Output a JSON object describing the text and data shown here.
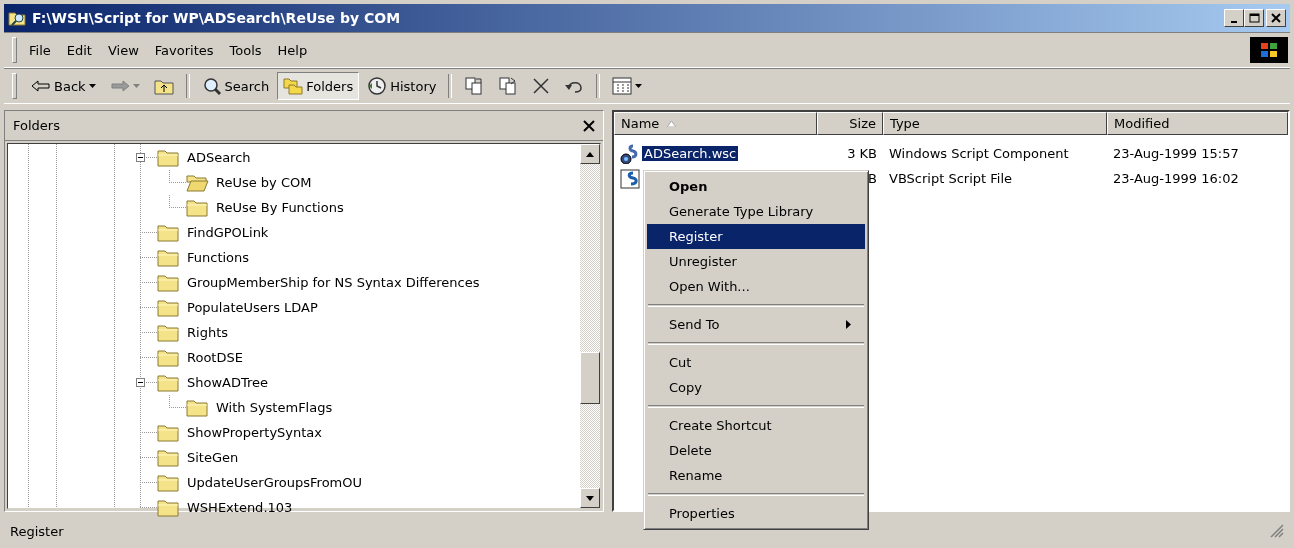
{
  "window": {
    "title": "F:\\WSH\\Script for WP\\ADSearch\\ReUse by COM"
  },
  "menu_bar": [
    "File",
    "Edit",
    "View",
    "Favorites",
    "Tools",
    "Help"
  ],
  "toolbar": [
    {
      "kind": "back",
      "label": "Back",
      "dropdown": true,
      "disabled": false
    },
    {
      "kind": "forward",
      "dropdown": true,
      "disabled": true
    },
    {
      "kind": "up"
    },
    {
      "kind": "separator"
    },
    {
      "kind": "search",
      "label": "Search",
      "pressed": false
    },
    {
      "kind": "folders",
      "label": "Folders",
      "pressed": true
    },
    {
      "kind": "history",
      "label": "History",
      "pressed": false
    },
    {
      "kind": "separator"
    },
    {
      "kind": "moveto"
    },
    {
      "kind": "copyto"
    },
    {
      "kind": "delete"
    },
    {
      "kind": "undo"
    },
    {
      "kind": "separator"
    },
    {
      "kind": "views",
      "dropdown": true
    }
  ],
  "folders_pane": {
    "title": "Folders",
    "tree": [
      {
        "label": "ADSearch",
        "selected": false,
        "expanded": true,
        "children": [
          {
            "label": "ReUse by COM",
            "selected": true
          },
          {
            "label": "ReUse By Functions",
            "selected": false
          }
        ]
      },
      {
        "label": "FindGPOLink",
        "selected": false
      },
      {
        "label": "Functions",
        "selected": false
      },
      {
        "label": "GroupMemberShip for NS Syntax Differences",
        "selected": false
      },
      {
        "label": "PopulateUsers LDAP",
        "selected": false
      },
      {
        "label": "Rights",
        "selected": false
      },
      {
        "label": "RootDSE",
        "selected": false
      },
      {
        "label": "ShowADTree",
        "selected": false,
        "expanded": true,
        "children": [
          {
            "label": "With SystemFlags",
            "selected": false
          }
        ]
      },
      {
        "label": "ShowPropertySyntax",
        "selected": false
      },
      {
        "label": "SiteGen",
        "selected": false
      },
      {
        "label": "UpdateUserGroupsFromOU",
        "selected": false
      },
      {
        "label": "WSHExtend.103",
        "selected": false
      }
    ]
  },
  "file_list": {
    "columns": [
      {
        "label": "Name",
        "sorted": true
      },
      {
        "label": "Size"
      },
      {
        "label": "Type"
      },
      {
        "label": "Modified"
      }
    ],
    "rows": [
      {
        "kind": "component",
        "name": "ADSearch.wsc",
        "size": "3 KB",
        "type": "Windows Script Component",
        "modified": "23-Aug-1999 15:57",
        "selected": true
      },
      {
        "kind": "script",
        "size": "B",
        "type": "VBScript Script File",
        "modified": "23-Aug-1999 16:02",
        "selected": false
      }
    ]
  },
  "context_menu": [
    {
      "kind": "item",
      "label": "Open",
      "default": true,
      "selected": false,
      "submenu": false
    },
    {
      "kind": "item",
      "label": "Generate Type Library",
      "default": false,
      "selected": false,
      "submenu": false
    },
    {
      "kind": "item",
      "label": "Register",
      "default": false,
      "selected": true,
      "submenu": false
    },
    {
      "kind": "item",
      "label": "Unregister",
      "default": false,
      "selected": false,
      "submenu": false
    },
    {
      "kind": "item",
      "label": "Open With...",
      "default": false,
      "selected": false,
      "submenu": false
    },
    {
      "kind": "separator"
    },
    {
      "kind": "item",
      "label": "Send To",
      "default": false,
      "selected": false,
      "submenu": true
    },
    {
      "kind": "separator"
    },
    {
      "kind": "item",
      "label": "Cut",
      "default": false,
      "selected": false,
      "submenu": false
    },
    {
      "kind": "item",
      "label": "Copy",
      "default": false,
      "selected": false,
      "submenu": false
    },
    {
      "kind": "separator"
    },
    {
      "kind": "item",
      "label": "Create Shortcut",
      "default": false,
      "selected": false,
      "submenu": false
    },
    {
      "kind": "item",
      "label": "Delete",
      "default": false,
      "selected": false,
      "submenu": false
    },
    {
      "kind": "item",
      "label": "Rename",
      "default": false,
      "selected": false,
      "submenu": false
    },
    {
      "kind": "separator"
    },
    {
      "kind": "item",
      "label": "Properties",
      "default": false,
      "selected": false,
      "submenu": false
    }
  ],
  "status_bar": {
    "text": "Register"
  }
}
